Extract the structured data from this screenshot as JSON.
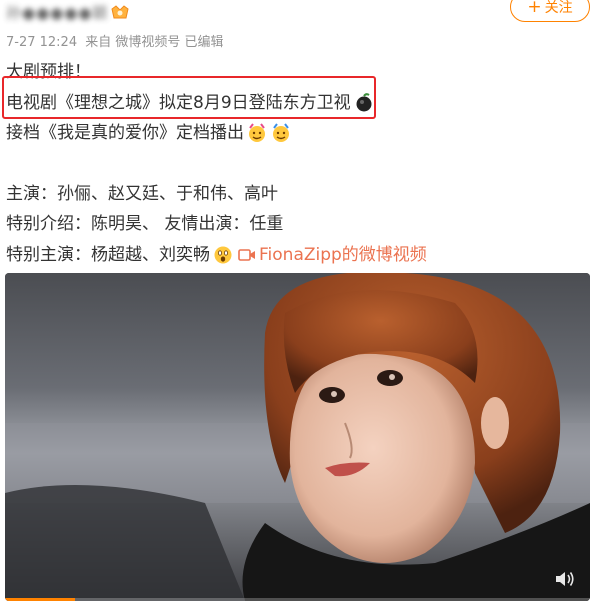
{
  "post": {
    "author_name": "孙●●●●●颖",
    "meta_time": "7-27 12:24",
    "meta_source": "来自 微博视频号 已编辑",
    "follow_label": "关注",
    "follow_plus": "+"
  },
  "content": {
    "line1": "大剧预排！",
    "line2": "电视剧《理想之城》拟定8月9日登陆东方卫视",
    "line3": "接档《我是真的爱你》定档播出",
    "line5": "主演：孙俪、赵又廷、于和伟、高叶",
    "line6": "特别介绍：陈明昊、 友情出演：任重",
    "line7_prefix": "特别主演：杨超越、刘奕畅",
    "video_link": "FionaZipp的微博视频"
  },
  "icons": {
    "vip": "vip-badge-icon",
    "tv": "tv-station-icon",
    "emoji_celebrate": "celebrate-emoji-icon",
    "emoji_scared": "scared-emoji-icon",
    "video": "video-camera-icon",
    "volume": "volume-icon"
  },
  "colors": {
    "accent": "#ff8200",
    "link": "#eb7350",
    "meta": "#939393",
    "highlight": "#e8272a"
  },
  "video": {
    "progress": 0.12
  }
}
